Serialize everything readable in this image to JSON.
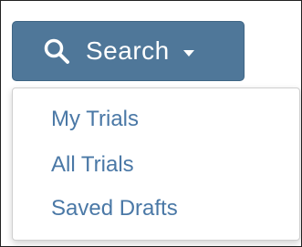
{
  "search_button": {
    "label": "Search",
    "icon": "search-icon",
    "caret_icon": "caret-down-icon",
    "background": "#4f7799",
    "text_color": "#ffffff"
  },
  "dropdown": {
    "items": [
      {
        "label": "My Trials"
      },
      {
        "label": "All Trials"
      },
      {
        "label": "Saved Drafts"
      }
    ],
    "link_color": "#4a78a6"
  }
}
